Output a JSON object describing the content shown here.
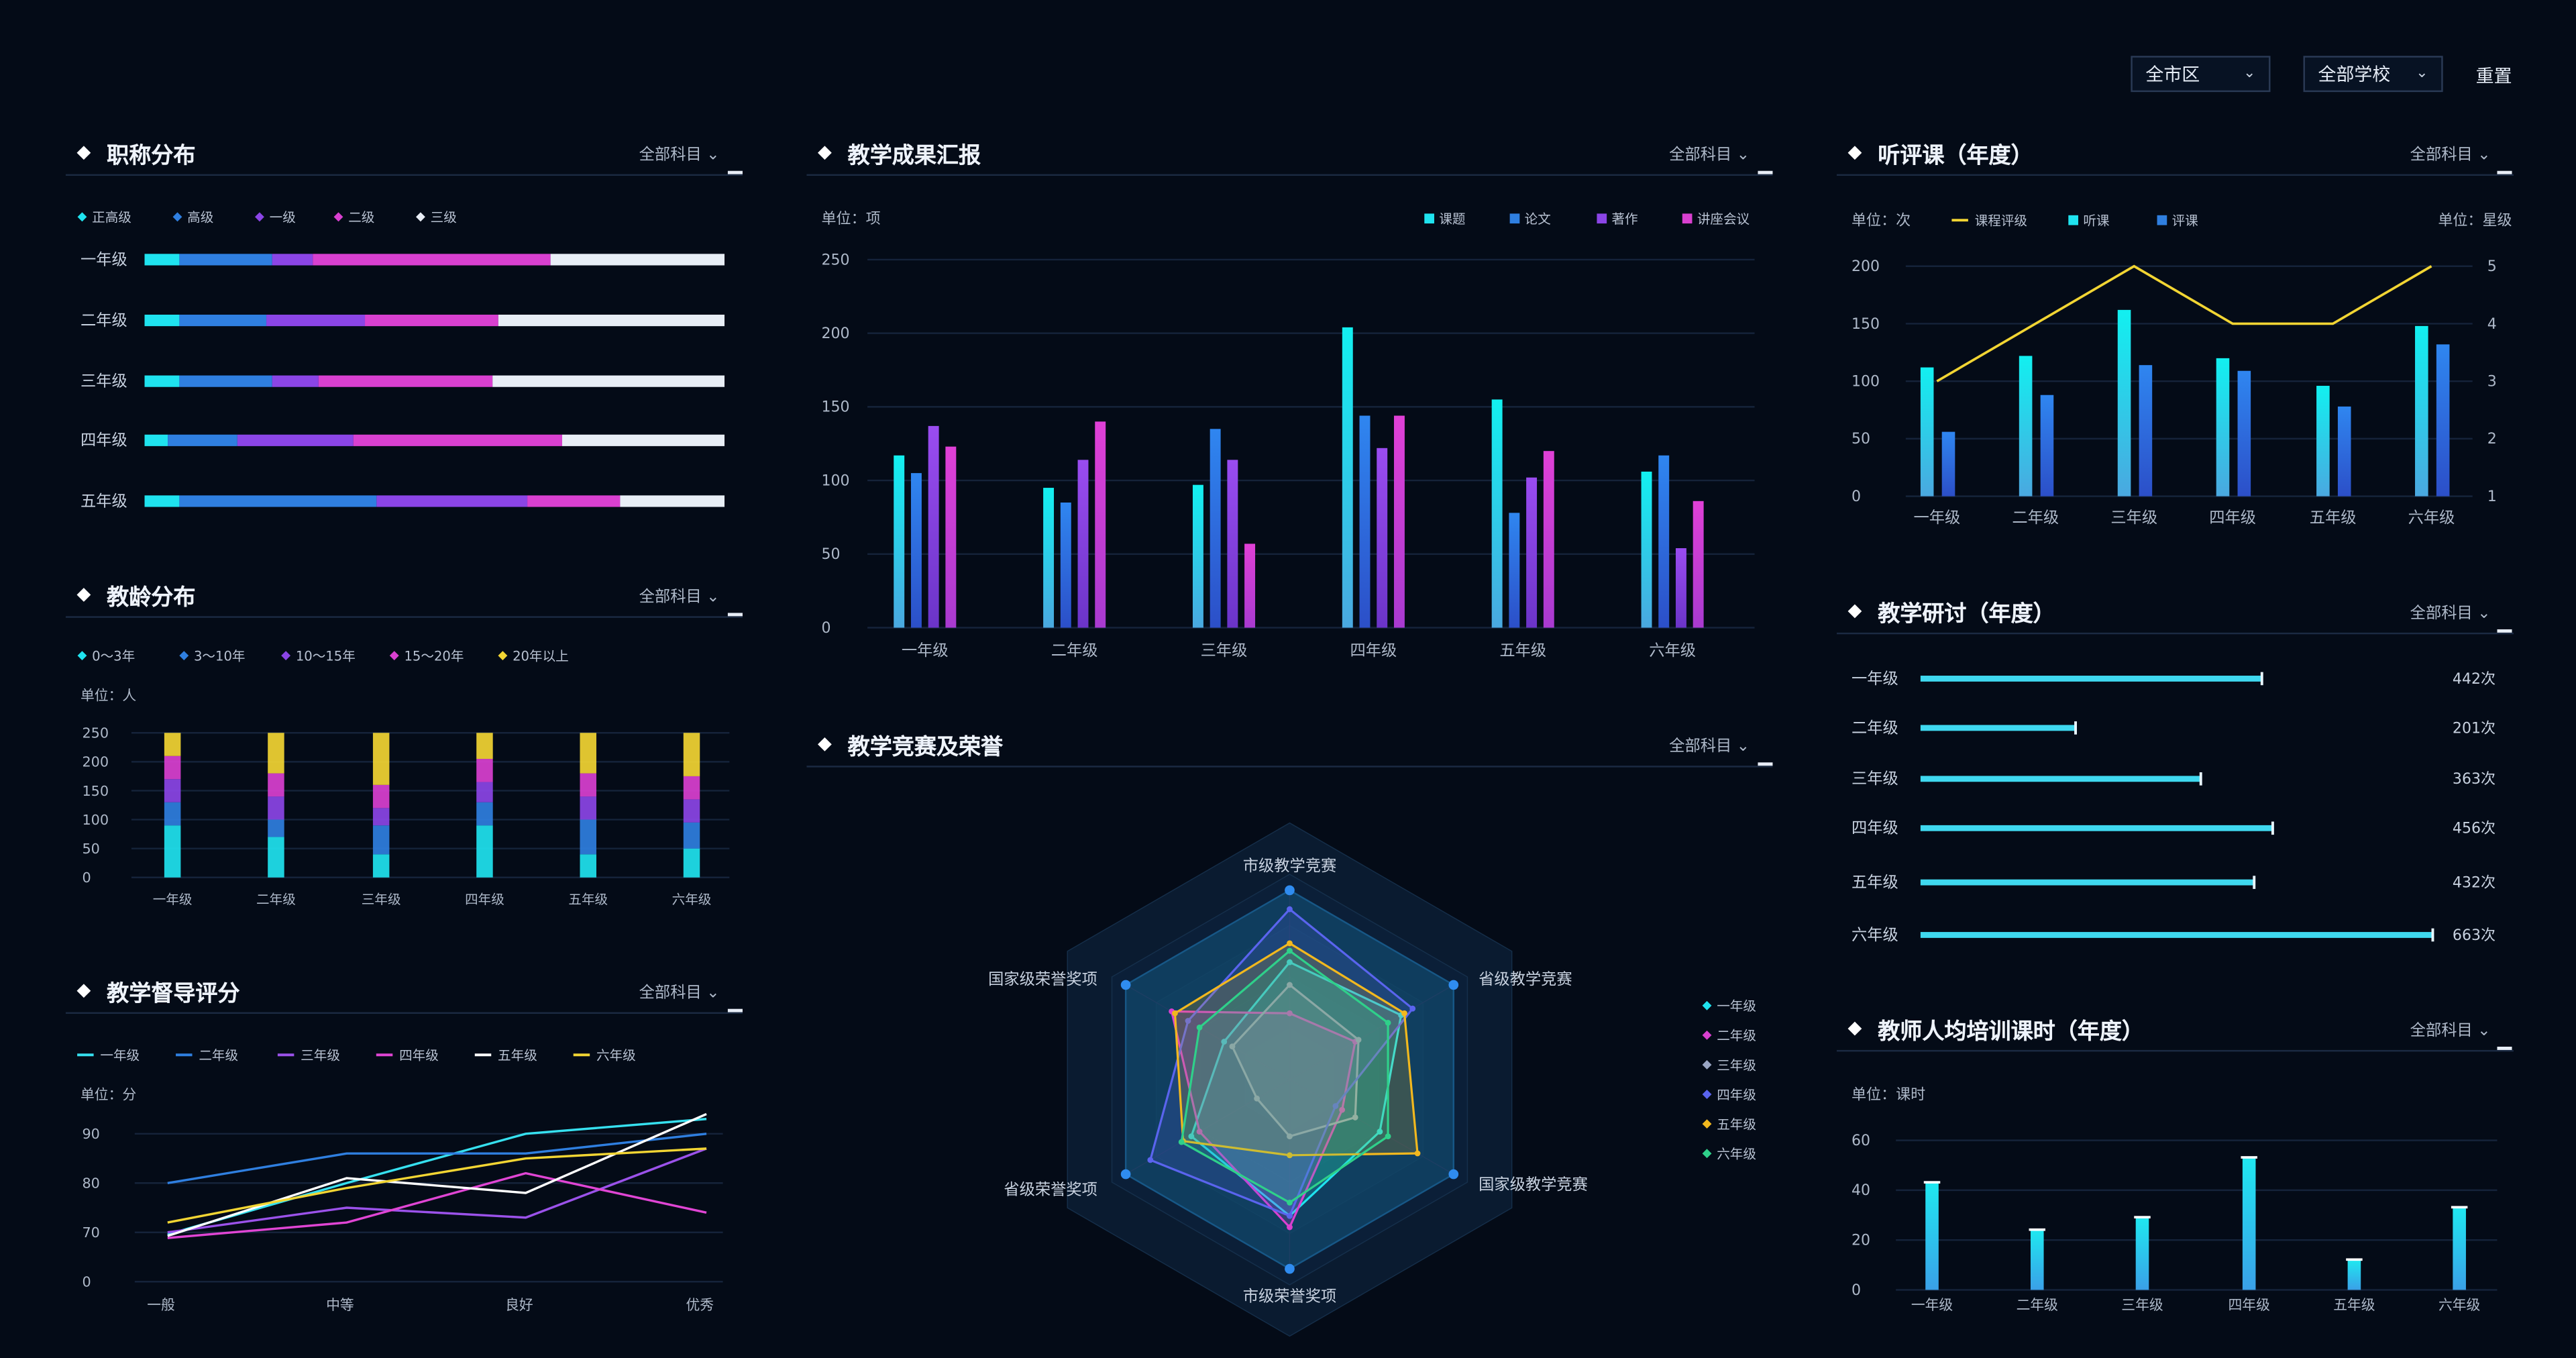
{
  "filters": {
    "district": "全市区",
    "school": "全部学校",
    "reset": "重置"
  },
  "panels": {
    "title_dist": {
      "title": "职称分布",
      "subject": "全部科目"
    },
    "teach_age": {
      "title": "教龄分布",
      "subject": "全部科目"
    },
    "supervision": {
      "title": "教学督导评分",
      "subject": "全部科目"
    },
    "results": {
      "title": "教学成果汇报",
      "subject": "全部科目"
    },
    "competition": {
      "title": "教学竞赛及荣誉",
      "subject": "全部科目"
    },
    "lectures": {
      "title": "听评课（年度）",
      "subject": "全部科目"
    },
    "research": {
      "title": "教学研讨（年度）",
      "subject": "全部科目"
    },
    "training": {
      "title": "教师人均培训课时（年度）",
      "subject": "全部科目"
    }
  },
  "colors": {
    "bg": "#040b17",
    "cyan": "#19e6f0",
    "blue": "#2f7fe0",
    "purple": "#8b45e6",
    "magenta": "#d940d0",
    "yellow": "#f2d533"
  },
  "chart_data": [
    {
      "id": "title_dist",
      "type": "bar",
      "stacked": true,
      "orientation": "horizontal",
      "normalized": true,
      "categories": [
        "一年级",
        "二年级",
        "三年级",
        "四年级",
        "五年级"
      ],
      "series": [
        {
          "name": "正高级",
          "color": "#1fe3ef",
          "values": [
            6,
            6,
            6,
            4,
            6
          ]
        },
        {
          "name": "高级",
          "color": "#2f7fe0",
          "values": [
            16,
            15,
            16,
            12,
            34
          ]
        },
        {
          "name": "一级",
          "color": "#8b45e6",
          "values": [
            7,
            17,
            8,
            20,
            26
          ]
        },
        {
          "name": "二级",
          "color": "#d940d0",
          "values": [
            41,
            23,
            30,
            36,
            16
          ]
        },
        {
          "name": "三级",
          "color": "#e8eef6",
          "values": [
            30,
            39,
            40,
            28,
            18
          ]
        }
      ]
    },
    {
      "id": "teach_age",
      "type": "bar",
      "stacked": true,
      "unit": "单位：人",
      "categories": [
        "一年级",
        "二年级",
        "三年级",
        "四年级",
        "五年级",
        "六年级"
      ],
      "ylim": [
        0,
        250
      ],
      "yticks": [
        0,
        50,
        100,
        150,
        200,
        250
      ],
      "series": [
        {
          "name": "0～3年",
          "color": "#1fe3ef",
          "values": [
            90,
            70,
            40,
            90,
            40,
            50
          ]
        },
        {
          "name": "3～10年",
          "color": "#2f7fe0",
          "values": [
            40,
            30,
            50,
            40,
            60,
            45
          ]
        },
        {
          "name": "10～15年",
          "color": "#8b45e6",
          "values": [
            40,
            40,
            30,
            35,
            40,
            40
          ]
        },
        {
          "name": "15～20年",
          "color": "#d940d0",
          "values": [
            40,
            40,
            40,
            40,
            40,
            40
          ]
        },
        {
          "name": "20年以上",
          "color": "#f2d533",
          "values": [
            40,
            70,
            90,
            45,
            70,
            75
          ]
        }
      ]
    },
    {
      "id": "supervision",
      "type": "line",
      "unit": "单位：分",
      "categories": [
        "一般",
        "中等",
        "良好",
        "优秀"
      ],
      "yticks": [
        "0",
        "70",
        "80",
        "90"
      ],
      "series": [
        {
          "name": "一年级",
          "color": "#36e0ef",
          "values": [
            67,
            80,
            90,
            93
          ]
        },
        {
          "name": "二年级",
          "color": "#2f7fe0",
          "values": [
            80,
            86,
            86,
            90
          ]
        },
        {
          "name": "三年级",
          "color": "#9b52ea",
          "values": [
            70,
            75,
            73,
            87
          ]
        },
        {
          "name": "四年级",
          "color": "#e045d4",
          "values": [
            62,
            72,
            82,
            74
          ]
        },
        {
          "name": "五年级",
          "color": "#ffffff",
          "values": [
            65,
            81,
            78,
            94
          ]
        },
        {
          "name": "六年级",
          "color": "#f2d533",
          "values": [
            72,
            79,
            85,
            87
          ]
        }
      ]
    },
    {
      "id": "results",
      "type": "bar",
      "unit": "单位：项",
      "categories": [
        "一年级",
        "二年级",
        "三年级",
        "四年级",
        "五年级",
        "六年级"
      ],
      "ylim": [
        0,
        250
      ],
      "yticks": [
        0,
        50,
        100,
        150,
        200,
        250
      ],
      "series": [
        {
          "name": "课题",
          "color": "#1fe3ef",
          "values": [
            117,
            95,
            97,
            204,
            155,
            106
          ]
        },
        {
          "name": "论文",
          "color": "#2f7fe0",
          "values": [
            105,
            85,
            135,
            144,
            78,
            117
          ]
        },
        {
          "name": "著作",
          "color": "#8b45e6",
          "values": [
            137,
            114,
            114,
            122,
            102,
            54
          ]
        },
        {
          "name": "讲座会议",
          "color": "#d940d0",
          "values": [
            123,
            140,
            57,
            144,
            120,
            86
          ]
        }
      ]
    },
    {
      "id": "competition",
      "type": "radar",
      "indicators": [
        "市级教学竞赛",
        "省级教学竞赛",
        "国家级教学竞赛",
        "市级荣誉奖项",
        "省级荣誉奖项",
        "国家级荣誉奖项"
      ],
      "max": 100,
      "series": [
        {
          "name": "一年级",
          "color": "#1fe3ef",
          "values": [
            62,
            68,
            55,
            72,
            60,
            40
          ]
        },
        {
          "name": "二年级",
          "color": "#d940d0",
          "values": [
            35,
            40,
            32,
            78,
            55,
            72
          ]
        },
        {
          "name": "三年级",
          "color": "#9aa6c4",
          "values": [
            50,
            42,
            40,
            30,
            20,
            35
          ]
        },
        {
          "name": "四年级",
          "color": "#5a64ee",
          "values": [
            90,
            75,
            28,
            72,
            85,
            62
          ]
        },
        {
          "name": "五年级",
          "color": "#f2b81e",
          "values": [
            72,
            70,
            78,
            40,
            65,
            70
          ]
        },
        {
          "name": "六年级",
          "color": "#2fd08a",
          "values": [
            68,
            60,
            60,
            65,
            66,
            55
          ]
        }
      ]
    },
    {
      "id": "lectures",
      "type": "bar+line",
      "unit_left": "单位：次",
      "unit_right": "单位：星级",
      "categories": [
        "一年级",
        "二年级",
        "三年级",
        "四年级",
        "五年级",
        "六年级"
      ],
      "ylim": [
        0,
        200
      ],
      "yticks": [
        0,
        50,
        100,
        150,
        200
      ],
      "y2ticks": [
        1,
        2,
        3,
        4,
        5
      ],
      "series": [
        {
          "name": "课程评级",
          "type": "line",
          "color": "#f2d533",
          "values": [
            3,
            4,
            5,
            4,
            4,
            5
          ]
        },
        {
          "name": "听课",
          "type": "bar",
          "color": "#1fe3ef",
          "values": [
            112,
            122,
            162,
            120,
            96,
            148
          ]
        },
        {
          "name": "评课",
          "type": "bar",
          "color": "#2f7fe0",
          "values": [
            56,
            88,
            114,
            109,
            78,
            132
          ]
        }
      ]
    },
    {
      "id": "research",
      "type": "bar",
      "orientation": "horizontal",
      "categories": [
        "一年级",
        "二年级",
        "三年级",
        "四年级",
        "五年级",
        "六年级"
      ],
      "values": [
        442,
        201,
        363,
        456,
        432,
        663
      ],
      "value_labels": [
        "442次",
        "201次",
        "363次",
        "456次",
        "432次",
        "663次"
      ],
      "xlim": [
        0,
        663
      ]
    },
    {
      "id": "training",
      "type": "bar",
      "unit": "单位：课时",
      "categories": [
        "一年级",
        "二年级",
        "三年级",
        "四年级",
        "五年级",
        "六年级"
      ],
      "ylim": [
        0,
        60
      ],
      "yticks": [
        0,
        20,
        40,
        60
      ],
      "values": [
        43,
        24,
        29,
        53,
        12,
        33
      ]
    }
  ]
}
